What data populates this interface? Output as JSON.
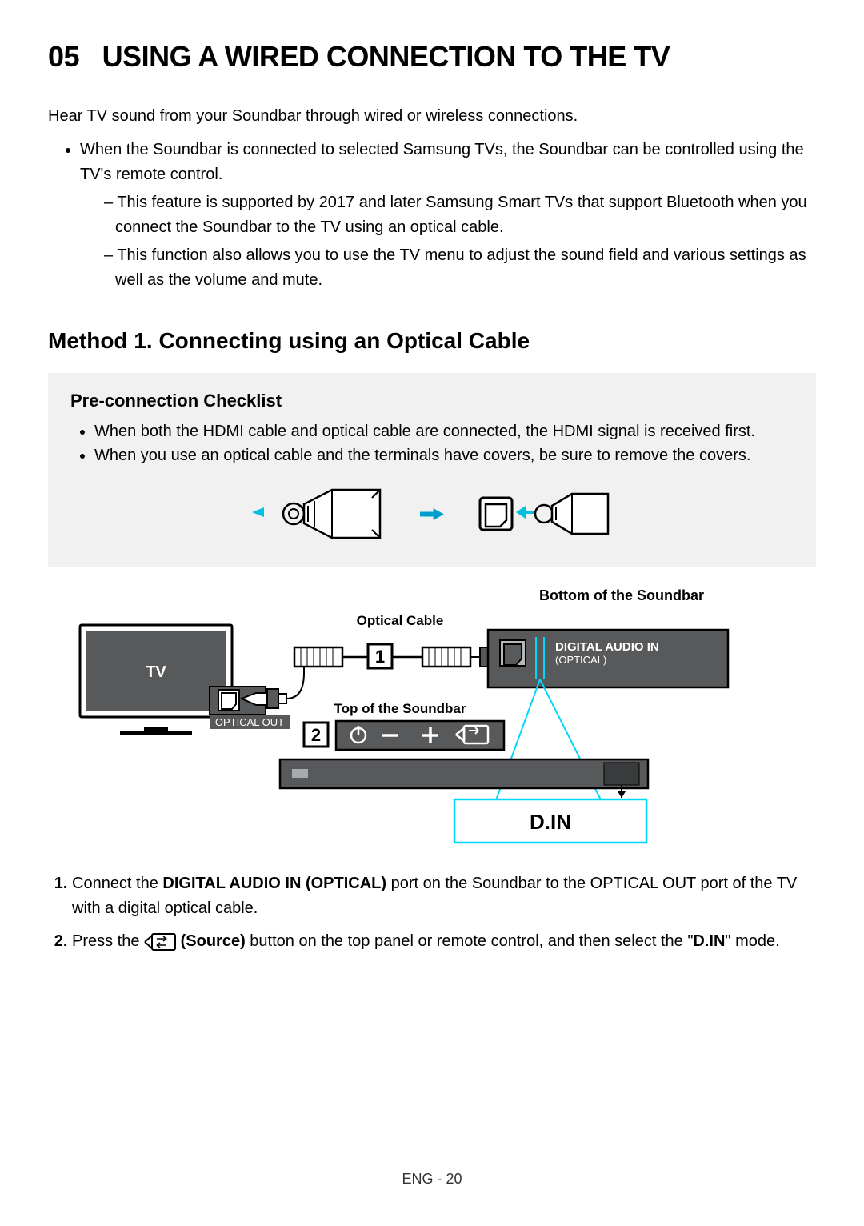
{
  "section_number": "05",
  "section_title": "USING A WIRED CONNECTION TO THE TV",
  "intro": "Hear TV sound from your Soundbar through wired or wireless connections.",
  "bullet1": "When the Soundbar is connected to selected Samsung TVs, the Soundbar can be controlled using the TV's remote control.",
  "sub1": "This feature is supported by 2017 and later Samsung Smart TVs that support Bluetooth when you connect the Soundbar to the TV using an optical cable.",
  "sub2": "This function also allows you to use the TV menu to adjust the sound field and various settings as well as the volume and mute.",
  "method_heading": "Method 1. Connecting using an Optical Cable",
  "checklist_title": "Pre-connection Checklist",
  "check1": "When both the HDMI cable and optical cable are connected, the HDMI signal is received first.",
  "check2": "When you use an optical cable and the terminals have covers, be sure to remove the covers.",
  "diagram": {
    "bottom_label": "Bottom of the Soundbar",
    "optical_cable_label": "Optical Cable",
    "tv_label": "TV",
    "optical_out_label": "OPTICAL OUT",
    "digital_audio_in_line1": "DIGITAL AUDIO IN",
    "digital_audio_in_line2": "(OPTICAL)",
    "top_label": "Top of the Soundbar",
    "step1_marker": "1",
    "step2_marker": "2",
    "din_label": "D.IN"
  },
  "step1_pre": "Connect the ",
  "step1_bold": "DIGITAL AUDIO IN (OPTICAL)",
  "step1_post": " port on the Soundbar to the OPTICAL OUT port of the TV with a digital optical cable.",
  "step2_pre": "Press the ",
  "step2_source": "(Source)",
  "step2_mid": " button on the top panel or remote control, and then select the \"",
  "step2_din": "D.IN",
  "step2_post": "\" mode.",
  "footer": "ENG - 20"
}
